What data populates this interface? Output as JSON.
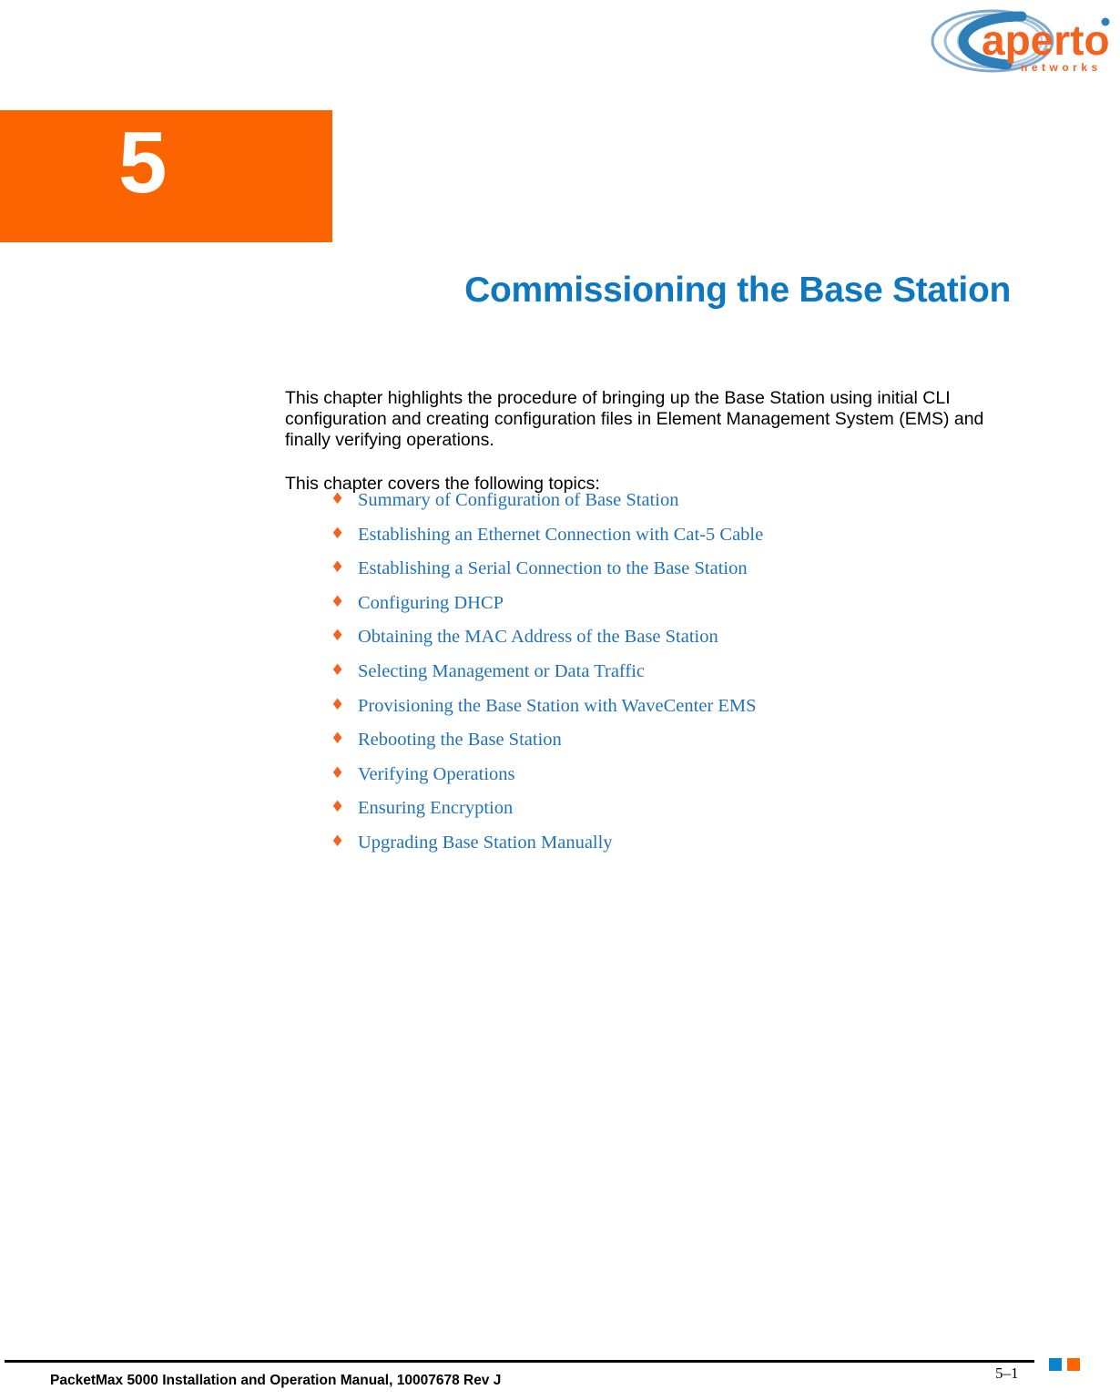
{
  "logo": {
    "wordmark": "aperto",
    "tagline": "networks",
    "brand_orange": "#F4621F",
    "brand_blue": "#4A8DC0",
    "trademark_mark": "®"
  },
  "chapter": {
    "number": "5",
    "title": "Commissioning the Base Station",
    "block_color": "#FB6400",
    "title_color": "#0F77BE"
  },
  "body": {
    "intro_paragraph": "This chapter highlights the procedure of bringing up the Base Station using initial CLI configuration and creating configuration files in Element Management System (EMS) and finally verifying operations.",
    "topics_lead": "This chapter covers the following topics:"
  },
  "topics": {
    "bullet_glyph": "♦",
    "bullet_color": "#F4621F",
    "link_color": "#2273B5",
    "items": [
      {
        "label": "Summary of Configuration of Base Station"
      },
      {
        "label": "Establishing an Ethernet Connection with Cat-5 Cable"
      },
      {
        "label": "Establishing a Serial Connection to the Base Station"
      },
      {
        "label": "Configuring DHCP"
      },
      {
        "label": "Obtaining the MAC Address of the Base Station"
      },
      {
        "label": "Selecting Management or Data Traffic"
      },
      {
        "label": "Provisioning the Base Station with WaveCenter EMS"
      },
      {
        "label": "Rebooting the Base Station"
      },
      {
        "label": "Verifying Operations"
      },
      {
        "label": "Ensuring Encryption"
      },
      {
        "label": "Upgrading Base Station Manually"
      }
    ]
  },
  "footer": {
    "document_line": "PacketMax 5000 Installation and Operation Manual,   10007678 Rev J",
    "page_number": "5–1",
    "marker_blue": "#0A82CC",
    "marker_orange": "#FB6400"
  }
}
